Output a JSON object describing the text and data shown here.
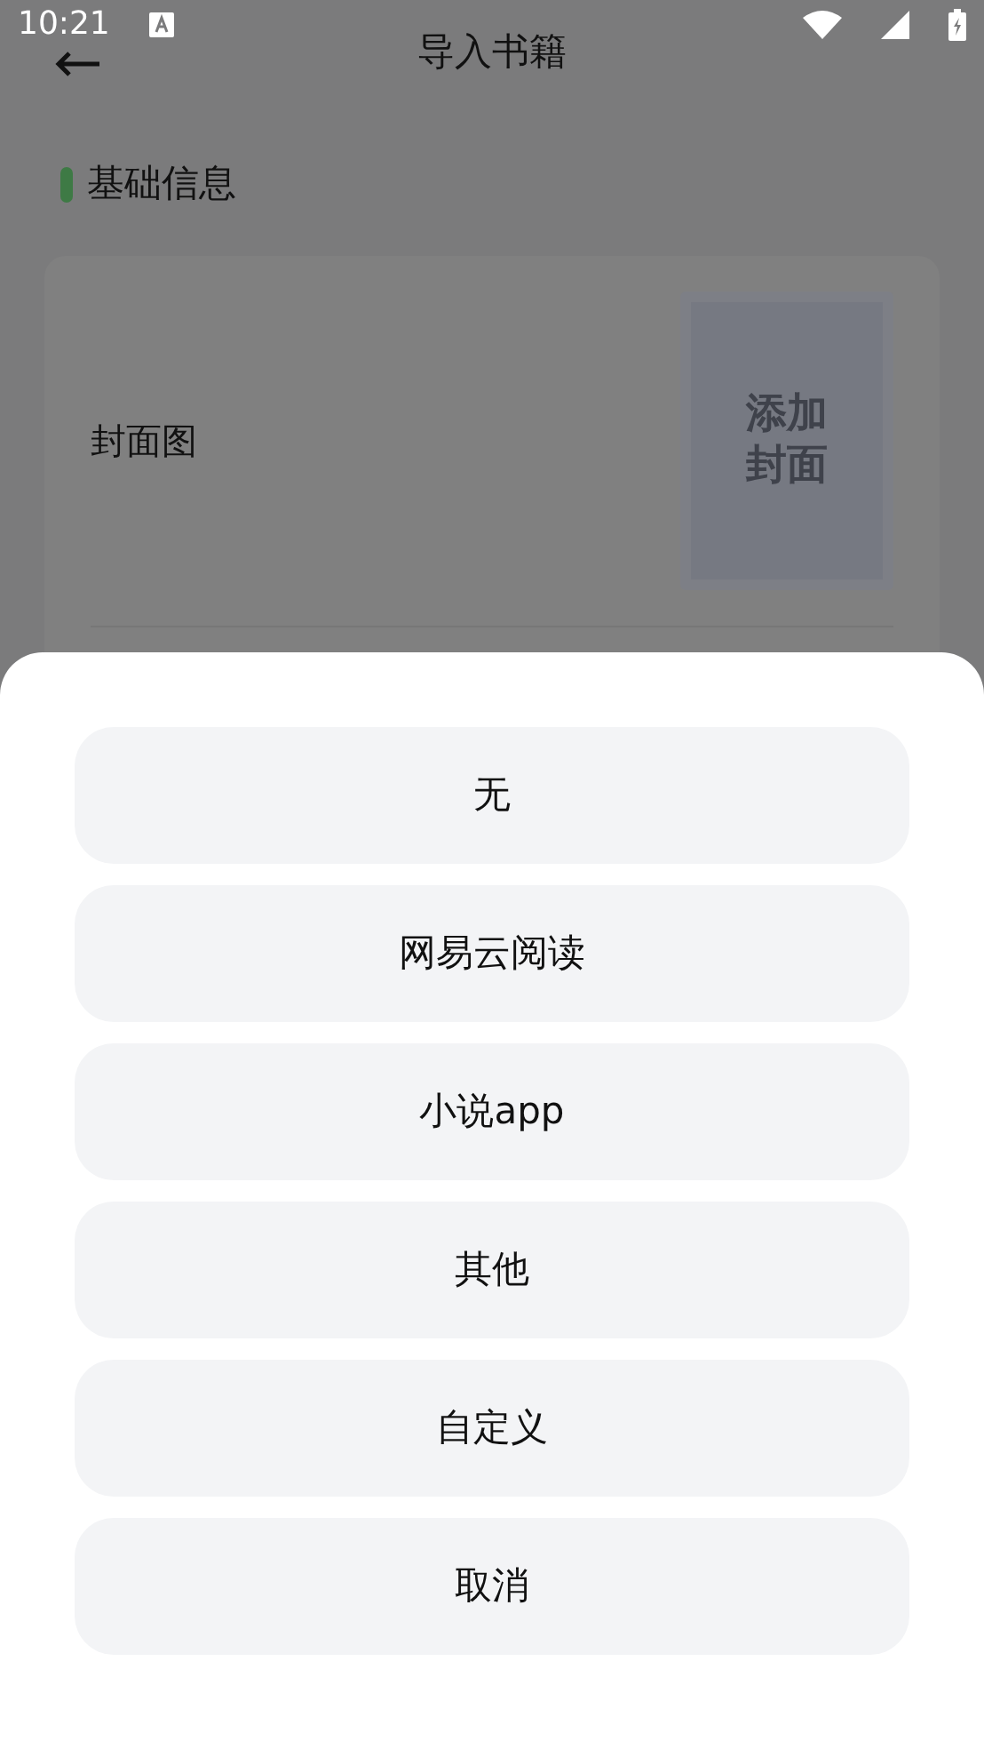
{
  "status_bar": {
    "time": "10:21"
  },
  "app_bar": {
    "title": "导入书籍"
  },
  "section": {
    "title": "基础信息"
  },
  "form": {
    "cover_label": "封面图",
    "cover_placeholder": "添加封面"
  },
  "sheet": {
    "options": [
      {
        "label": "无"
      },
      {
        "label": "网易云阅读"
      },
      {
        "label": "小说app"
      },
      {
        "label": "其他"
      },
      {
        "label": "自定义"
      },
      {
        "label": "取消"
      }
    ]
  }
}
